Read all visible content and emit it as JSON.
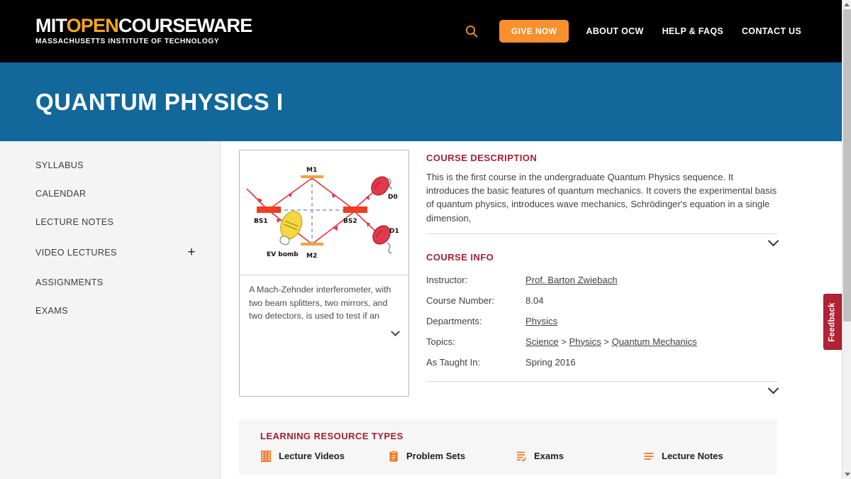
{
  "header": {
    "logo_main_1": "MIT",
    "logo_main_open": "OPEN",
    "logo_main_2": "COURSEWARE",
    "logo_sub": "MASSACHUSETTS INSTITUTE OF TECHNOLOGY",
    "search_icon": "search-icon",
    "give_now_label": "GIVE NOW",
    "nav": [
      {
        "label": "ABOUT OCW"
      },
      {
        "label": "HELP & FAQS"
      },
      {
        "label": "CONTACT US"
      }
    ],
    "accent_orange": "#f7902d",
    "background": "#000000"
  },
  "banner": {
    "title": "QUANTUM PHYSICS I",
    "background": "#12679b"
  },
  "sidebar": {
    "items": [
      {
        "label": "SYLLABUS",
        "expandable": false
      },
      {
        "label": "CALENDAR",
        "expandable": false
      },
      {
        "label": "LECTURE NOTES",
        "expandable": false
      },
      {
        "label": "VIDEO LECTURES",
        "expandable": true,
        "expander": "+"
      },
      {
        "label": "ASSIGNMENTS",
        "expandable": false
      },
      {
        "label": "EXAMS",
        "expandable": false
      }
    ]
  },
  "course_image": {
    "alt": "Mach-Zehnder interferometer diagram",
    "labels": {
      "m1": "M1",
      "m2": "M2",
      "bs1": "BS1",
      "bs2": "BS2",
      "d0": "D0",
      "d1": "D1",
      "bomb": "EV bomb"
    },
    "colors": {
      "beam": "#e8323c",
      "mirror": "#f2a33c",
      "beamsplitter": "#f03c20",
      "detector": "#e03a4e",
      "bomb": "#f5d742",
      "guide": "#6a7fd0"
    },
    "caption": "A Mach-Zehnder interferometer, with two beam splitters, two mirrors, and two detectors, is used to test if an",
    "caption_expand_icon": "chevron-down-icon"
  },
  "course_description": {
    "heading": "COURSE DESCRIPTION",
    "body": "This is the first course in the undergraduate Quantum Physics sequence. It introduces the basic features of quantum mechanics. It covers the experimental basis of quantum physics, introduces wave mechanics, Schrödinger's equation in a single dimension,",
    "expand_icon": "chevron-down-icon",
    "heading_color": "#a31f34"
  },
  "course_info": {
    "heading": "COURSE INFO",
    "rows": [
      {
        "key": "Instructor:",
        "value": "Prof. Barton Zwiebach",
        "link": true
      },
      {
        "key": "Course Number:",
        "value": "8.04",
        "link": false
      },
      {
        "key": "Departments:",
        "value": "Physics",
        "link": true
      },
      {
        "key": "Topics:",
        "value": "",
        "link": false,
        "topic_path": [
          "Science",
          "Physics",
          "Quantum Mechanics"
        ],
        "separator": ">"
      },
      {
        "key": "As Taught In:",
        "value": "Spring 2016",
        "link": false
      }
    ],
    "expand_icon": "chevron-down-icon"
  },
  "learning_resource_types": {
    "heading": "LEARNING RESOURCE TYPES",
    "items": [
      {
        "label": "Lecture Videos",
        "icon": "film-strip-icon"
      },
      {
        "label": "Problem Sets",
        "icon": "clipboard-icon"
      },
      {
        "label": "Exams",
        "icon": "checklist-icon"
      },
      {
        "label": "Lecture Notes",
        "icon": "lines-icon"
      }
    ],
    "icon_color": "#ee7623",
    "background": "#f6f6f6"
  },
  "feedback": {
    "label": "Feedback",
    "color": "#b32134"
  },
  "scrollbar": {
    "up_icon": "scroll-up-arrow-icon",
    "down_icon": "scroll-down-arrow-icon"
  }
}
